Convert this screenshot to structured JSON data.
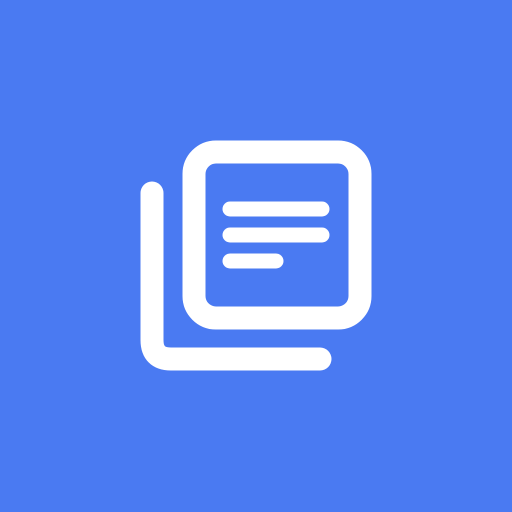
{
  "icon": {
    "name": "library-documents-icon",
    "background_color": "#4A7AF2",
    "glyph_color": "#FFFFFF"
  }
}
